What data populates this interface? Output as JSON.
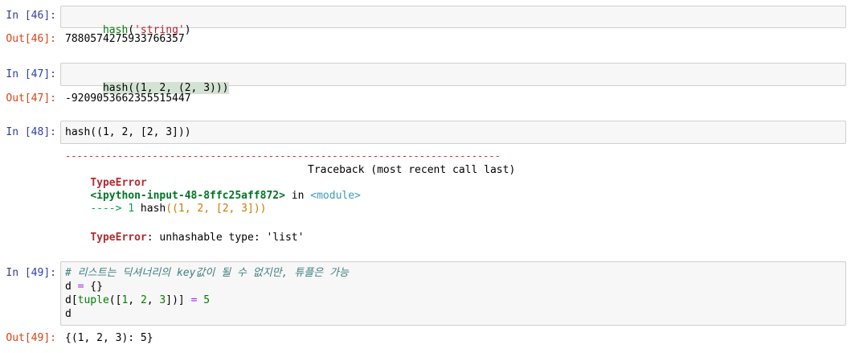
{
  "cells": [
    {
      "in_prompt": "In [46]:",
      "code": {
        "fn": "hash",
        "open": "(",
        "str": "'string'",
        "close": ")"
      },
      "out_prompt": "Out[46]:",
      "output": "7880574275933766357"
    },
    {
      "in_prompt": "In [47]:",
      "code": {
        "line": "hash((1, 2, (2, 3)))"
      },
      "out_prompt": "Out[47]:",
      "output": "-9209053662355515447"
    },
    {
      "in_prompt": "In [48]:",
      "code": {
        "line": "hash((1, 2, [2, 3]))"
      },
      "error": {
        "rule": "---------------------------------------------------------------------------",
        "type_name": "TypeError",
        "traceback_label": "Traceback (most recent call last)",
        "input_ref": "<ipython-input-48-8ffc25aff872>",
        "in_word": " in ",
        "module": "<module>",
        "arrow": "----> 1",
        "arrow_code_fn": " hash",
        "arrow_code_args": "((1, 2, [2, 3]))",
        "message_type": "TypeError",
        "message": ": unhashable type: 'list'"
      }
    },
    {
      "in_prompt": "In [49]:",
      "code_lines": [
        "# 리스트는 딕셔너리의 key값이 될 수 없지만, 튜플은 가능",
        "d = {}",
        "d[tuple([1, 2, 3])] = 5",
        "d"
      ],
      "out_prompt": "Out[49]:",
      "output": "{(1, 2, 3): 5}"
    }
  ]
}
